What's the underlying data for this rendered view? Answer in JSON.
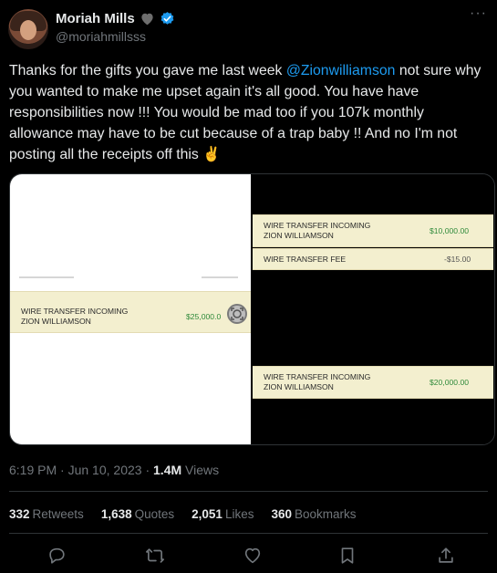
{
  "author": {
    "display_name": "Moriah Mills",
    "handle": "@moriahmillsss"
  },
  "tweet": {
    "text_before": "Thanks for the gifts you gave me last week ",
    "mention": "@Zionwilliamson",
    "text_after": " not sure why you wanted to make me upset again it's all good. You have have responsibilities now !!! You would be mad too if you 107k monthly allowance may have to be cut because of a trap baby !! And no I'm not posting all the receipts off this ✌️"
  },
  "media": {
    "left": {
      "line1": "WIRE TRANSFER INCOMING",
      "line2": "ZION WILLIAMSON",
      "amount": "$25,000.0"
    },
    "right": [
      {
        "line1": "WIRE TRANSFER INCOMING",
        "line2": "ZION WILLIAMSON",
        "amount": "$10,000.00"
      },
      {
        "line1": "WIRE TRANSFER FEE",
        "line2": "",
        "amount": "-$15.00"
      },
      {
        "line1": "WIRE TRANSFER INCOMING",
        "line2": "ZION WILLIAMSON",
        "amount": "$20,000.00"
      }
    ]
  },
  "meta": {
    "time": "6:19 PM",
    "separator": "·",
    "date": "Jun 10, 2023",
    "views_count": "1.4M",
    "views_label": "Views"
  },
  "stats": {
    "retweets_count": "332",
    "retweets_label": "Retweets",
    "quotes_count": "1,638",
    "quotes_label": "Quotes",
    "likes_count": "2,051",
    "likes_label": "Likes",
    "bookmarks_count": "360",
    "bookmarks_label": "Bookmarks"
  },
  "more_glyph": "···",
  "colors": {
    "accent": "#1d9bf0",
    "text": "#e7e9ea",
    "muted": "#71767b",
    "amount_green": "#2f8a3a"
  },
  "icons": [
    "heart-icon",
    "verified-icon",
    "more-icon",
    "reply-icon",
    "retweet-icon",
    "like-icon",
    "bookmark-icon",
    "share-icon",
    "zoom-icon"
  ]
}
